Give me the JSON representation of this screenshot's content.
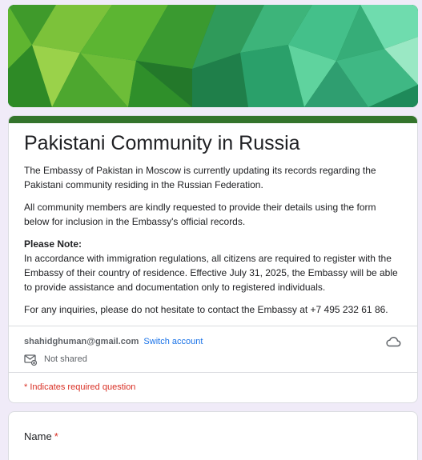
{
  "form": {
    "title": "Pakistani Community in Russia",
    "description_1": "The Embassy of Pakistan in Moscow is currently updating its records regarding the Pakistani community residing in the Russian Federation.",
    "description_2": "All community members are kindly requested to provide their details using the form below for inclusion in the Embassy's official records.",
    "note_heading": "Please Note:",
    "note_body": "In accordance with immigration regulations, all citizens are required to register with the Embassy of their country of residence. Effective July 31, 2025, the Embassy will be able to provide assistance and documentation only to registered individuals.",
    "description_4": "For any inquiries, please do not hesitate to contact the Embassy at +7 495 232 61 86.",
    "accent_color": "#34742c"
  },
  "account": {
    "email": "shahidghuman@gmail.com",
    "switch_label": "Switch account",
    "shared_status": "Not shared"
  },
  "required_note": "* Indicates required question",
  "questions": [
    {
      "label": "Name",
      "required_marker": "*"
    }
  ],
  "icons": {
    "cloud": "cloud-icon",
    "mail": "mail-not-shared-icon"
  }
}
